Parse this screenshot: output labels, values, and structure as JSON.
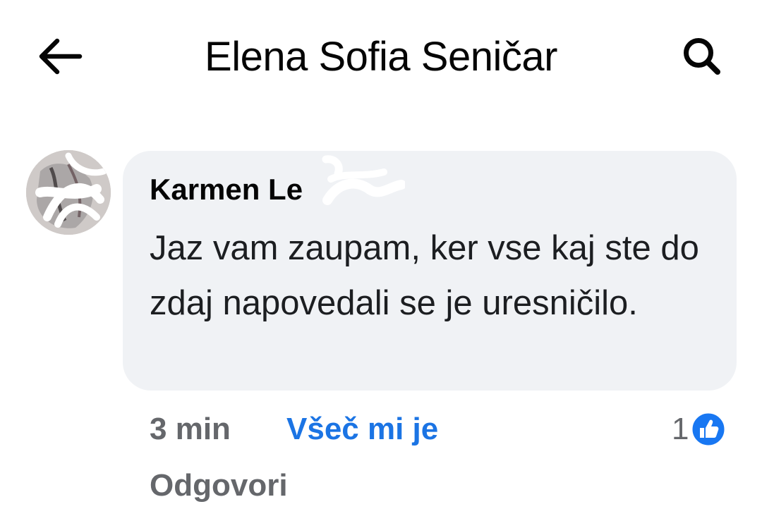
{
  "header": {
    "title": "Elena Sofia Seničar",
    "back_icon": "arrow-left-icon",
    "search_icon": "search-icon"
  },
  "comment": {
    "author": "Karmen Le",
    "text": "Jaz vam zaupam, ker vse kaj ste do zdaj napovedali se je uresničilo.",
    "time": "3 min",
    "like_label": "Všeč mi je",
    "reply_label": "Odgovori",
    "reaction_count": "1",
    "reaction_icon": "thumbs-up-icon"
  },
  "colors": {
    "like_blue": "#1b74e4",
    "meta_gray": "#65676b",
    "bubble_bg": "#f0f2f5"
  }
}
